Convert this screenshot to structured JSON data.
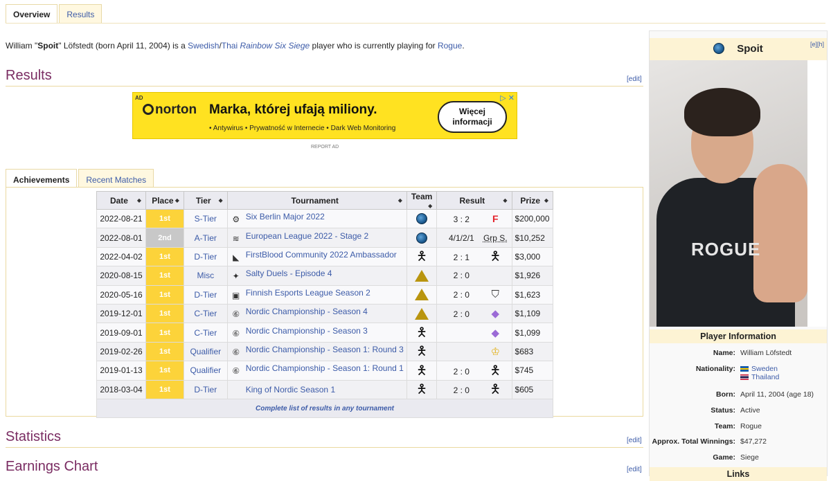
{
  "top_tabs": [
    {
      "label": "Overview",
      "active": true
    },
    {
      "label": "Results",
      "active": false
    }
  ],
  "intro": {
    "prefix": "William \"",
    "nickname": "Spoit",
    "mid": "\" Löfstedt (born April 11, 2004) is a ",
    "nat1": "Swedish",
    "slash": "/",
    "nat2": "Thai",
    "space": " ",
    "game": "Rainbow Six Siege",
    "mid2": " player who is currently playing for ",
    "team": "Rogue",
    "end": "."
  },
  "sections": {
    "results": "Results",
    "statistics": "Statistics",
    "earnings": "Earnings Chart",
    "edit": "[edit]"
  },
  "ad": {
    "tag": "AD",
    "brand": "norton",
    "headline": "Marka, której ufają miliony.",
    "bullets": "• Antywirus   • Prywatność w Internecie   • Dark Web Monitoring",
    "button_line1": "Więcej",
    "button_line2": "informacji",
    "report": "REPORT AD",
    "icons": "▷ ✕"
  },
  "ach_tabs": [
    {
      "label": "Achievements",
      "active": true
    },
    {
      "label": "Recent Matches",
      "active": false
    }
  ],
  "table": {
    "headers": [
      "Date",
      "Place",
      "Tier",
      "Tournament",
      "Team",
      "Result",
      "Prize"
    ],
    "rows": [
      {
        "date": "2022-08-21",
        "place": "1st",
        "place_type": "gold",
        "tier": "S-Tier",
        "ticon": "⚙",
        "tournament": "Six Berlin Major 2022",
        "team": "rogue",
        "score": "3 : 2",
        "opp": "faze",
        "opp_text": "F",
        "prize": "$200,000"
      },
      {
        "date": "2022-08-01",
        "place": "2nd",
        "place_type": "silver",
        "tier": "A-Tier",
        "ticon": "≋",
        "tournament": "European League 2022 - Stage 2",
        "team": "rogue",
        "score": "4/1/2/1",
        "opp": "text",
        "opp_text": "Grp S.",
        "prize": "$10,252"
      },
      {
        "date": "2022-04-02",
        "place": "1st",
        "place_type": "gold",
        "tier": "D-Tier",
        "ticon": "◣",
        "tournament": "FirstBlood Community 2022 Ambassador",
        "team": "fig",
        "score": "2 : 1",
        "opp": "fig",
        "opp_text": "",
        "prize": "$3,000"
      },
      {
        "date": "2020-08-15",
        "place": "1st",
        "place_type": "gold",
        "tier": "Misc",
        "ticon": "✦",
        "tournament": "Salty Duels - Episode 4",
        "team": "tri",
        "score": "2 : 0",
        "opp": "none",
        "opp_text": "",
        "prize": "$1,926"
      },
      {
        "date": "2020-05-16",
        "place": "1st",
        "place_type": "gold",
        "tier": "D-Tier",
        "ticon": "▣",
        "tournament": "Finnish Esports League Season 2",
        "team": "tri",
        "score": "2 : 0",
        "opp": "shield",
        "opp_text": "⛉",
        "prize": "$1,623"
      },
      {
        "date": "2019-12-01",
        "place": "1st",
        "place_type": "gold",
        "tier": "C-Tier",
        "ticon": "⑥",
        "tournament": "Nordic Championship - Season 4",
        "team": "tri",
        "score": "2 : 0",
        "opp": "gem",
        "opp_text": "◆",
        "prize": "$1,109"
      },
      {
        "date": "2019-09-01",
        "place": "1st",
        "place_type": "gold",
        "tier": "C-Tier",
        "ticon": "⑥",
        "tournament": "Nordic Championship - Season 3",
        "team": "fig",
        "score": "",
        "opp": "gem",
        "opp_text": "◆",
        "prize": "$1,099"
      },
      {
        "date": "2019-02-26",
        "place": "1st",
        "place_type": "gold",
        "tier": "Qualifier",
        "ticon": "⑥",
        "tournament": "Nordic Championship - Season 1: Round 3",
        "team": "fig",
        "score": "",
        "opp": "crown",
        "opp_text": "♔",
        "prize": "$683"
      },
      {
        "date": "2019-01-13",
        "place": "1st",
        "place_type": "gold",
        "tier": "Qualifier",
        "ticon": "⑥",
        "tournament": "Nordic Championship - Season 1: Round 1",
        "team": "fig",
        "score": "2 : 0",
        "opp": "fig",
        "opp_text": "",
        "prize": "$745"
      },
      {
        "date": "2018-03-04",
        "place": "1st",
        "place_type": "gold",
        "tier": "D-Tier",
        "ticon": "",
        "tournament": "King of Nordic Season 1",
        "team": "fig",
        "score": "2 : 0",
        "opp": "fig",
        "opp_text": "",
        "prize": "$605"
      }
    ],
    "footer": "Complete list of results in any tournament"
  },
  "infobox": {
    "name": "Spoit",
    "edit_links": "[e][h]",
    "photo_text": "ROGUE",
    "section_title": "Player Information",
    "name_label": "Name:",
    "name_value": "William Löfstedt",
    "nationality_label": "Nationality:",
    "nationality_1": "Sweden",
    "nationality_2": "Thailand",
    "born_label": "Born:",
    "born_value": "April 11, 2004 (age 18)",
    "status_label": "Status:",
    "status_value": "Active",
    "team_label": "Team:",
    "team_value": "Rogue",
    "winnings_label": "Approx. Total Winnings:",
    "winnings_value": "$47,272",
    "game_label": "Game:",
    "game_value": "Siege",
    "links_title": "Links"
  },
  "colors": {
    "accent": "#7a2c62",
    "link": "#3c5ba8",
    "gold": "#fcd33a",
    "silver": "#c8c8c8",
    "header_bg": "#fdf3d4"
  }
}
